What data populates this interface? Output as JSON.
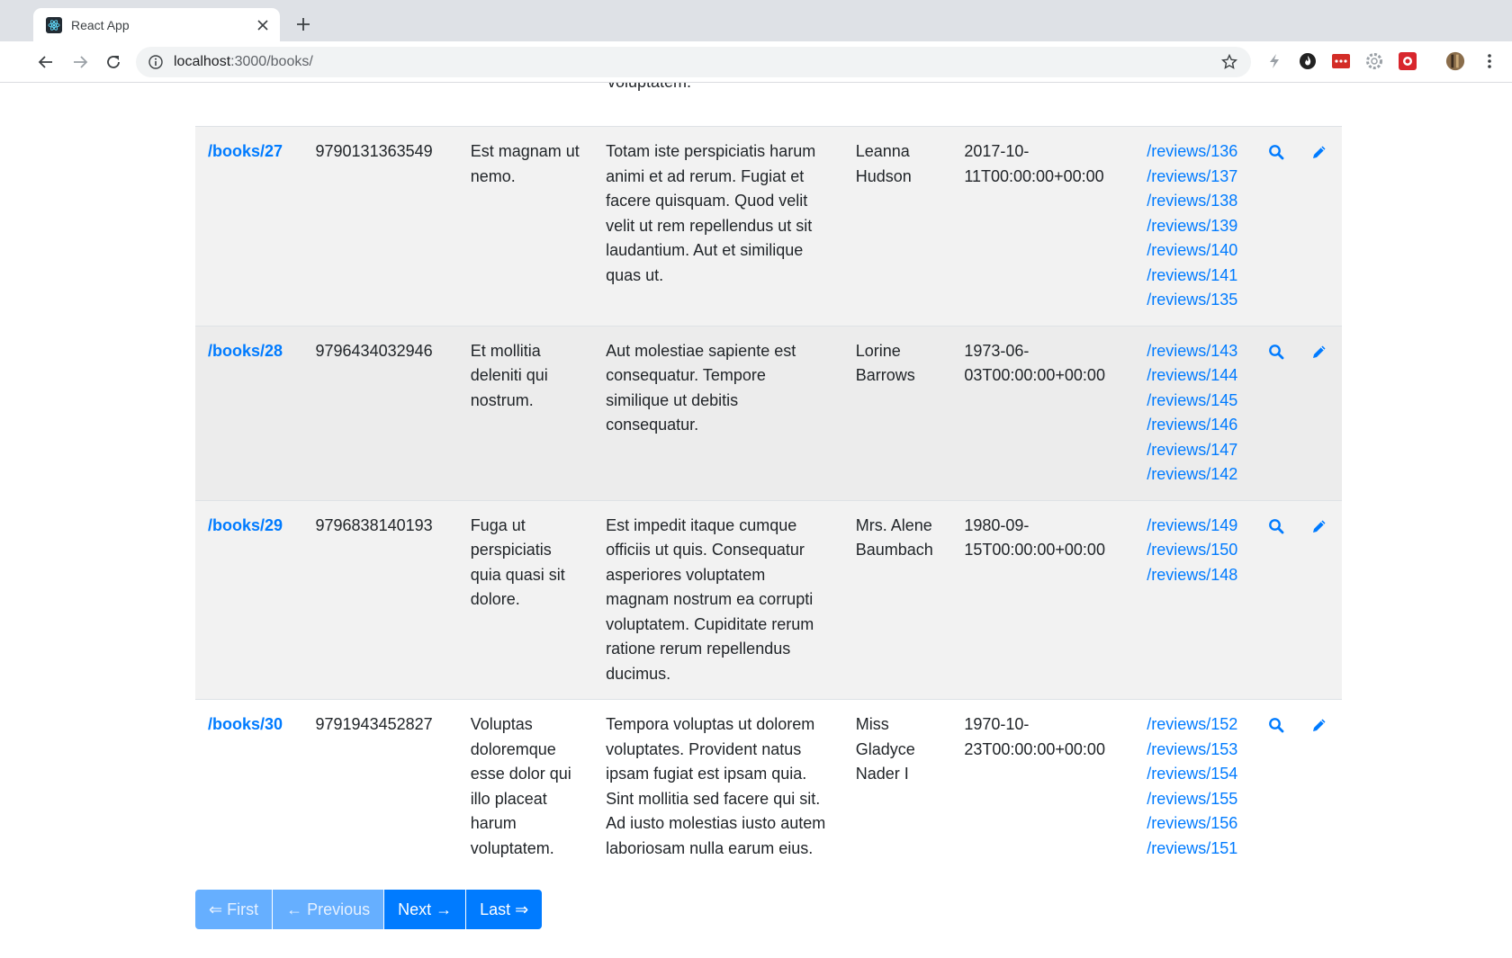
{
  "browser": {
    "tab_title": "React App",
    "url_host": "localhost",
    "url_rest": ":3000/books/"
  },
  "page": {
    "prev_row_tail": "voluptatem."
  },
  "rows": [
    {
      "id": "/books/27",
      "isbn": "9790131363549",
      "title": "Est magnam ut nemo.",
      "description": "Totam iste perspiciatis harum animi et ad rerum. Fugiat et facere quisquam. Quod velit velit ut rem repellendus ut sit laudantium. Aut et similique quas ut.",
      "author": "Leanna Hudson",
      "date_line1": "2017-10-",
      "date_line2": "11T00:00:00+00:00",
      "reviews": [
        "/reviews/136",
        "/reviews/137",
        "/reviews/138",
        "/reviews/139",
        "/reviews/140",
        "/reviews/141",
        "/reviews/135"
      ]
    },
    {
      "id": "/books/28",
      "isbn": "9796434032946",
      "title": "Et mollitia deleniti qui nostrum.",
      "description": "Aut molestiae sapiente est consequatur. Tempore similique ut debitis consequatur.",
      "author": "Lorine Barrows",
      "date_line1": "1973-06-",
      "date_line2": "03T00:00:00+00:00",
      "reviews": [
        "/reviews/143",
        "/reviews/144",
        "/reviews/145",
        "/reviews/146",
        "/reviews/147",
        "/reviews/142"
      ]
    },
    {
      "id": "/books/29",
      "isbn": "9796838140193",
      "title": "Fuga ut perspiciatis quia quasi sit dolore.",
      "description": "Est impedit itaque cumque officiis ut quis. Consequatur asperiores voluptatem magnam nostrum ea corrupti voluptatem. Cupiditate rerum ratione rerum repellendus ducimus.",
      "author": "Mrs. Alene Baumbach",
      "date_line1": "1980-09-",
      "date_line2": "15T00:00:00+00:00",
      "reviews": [
        "/reviews/149",
        "/reviews/150",
        "/reviews/148"
      ]
    },
    {
      "id": "/books/30",
      "isbn": "9791943452827",
      "title": "Voluptas doloremque esse dolor qui illo placeat harum voluptatem.",
      "description": "Tempora voluptas ut dolorem voluptates. Provident natus ipsam fugiat est ipsam quia. Sint mollitia sed facere qui sit. Ad iusto molestias iusto autem laboriosam nulla earum eius.",
      "author": "Miss Gladyce Nader I",
      "date_line1": "1970-10-",
      "date_line2": "23T00:00:00+00:00",
      "reviews": [
        "/reviews/152",
        "/reviews/153",
        "/reviews/154",
        "/reviews/155",
        "/reviews/156",
        "/reviews/151"
      ]
    }
  ],
  "pagination": {
    "first": "⇐ First",
    "previous": "← Previous",
    "next": "Next →",
    "last": "Last ⇒"
  },
  "colors": {
    "link": "#007bff",
    "stripe": "#f2f2f2"
  }
}
